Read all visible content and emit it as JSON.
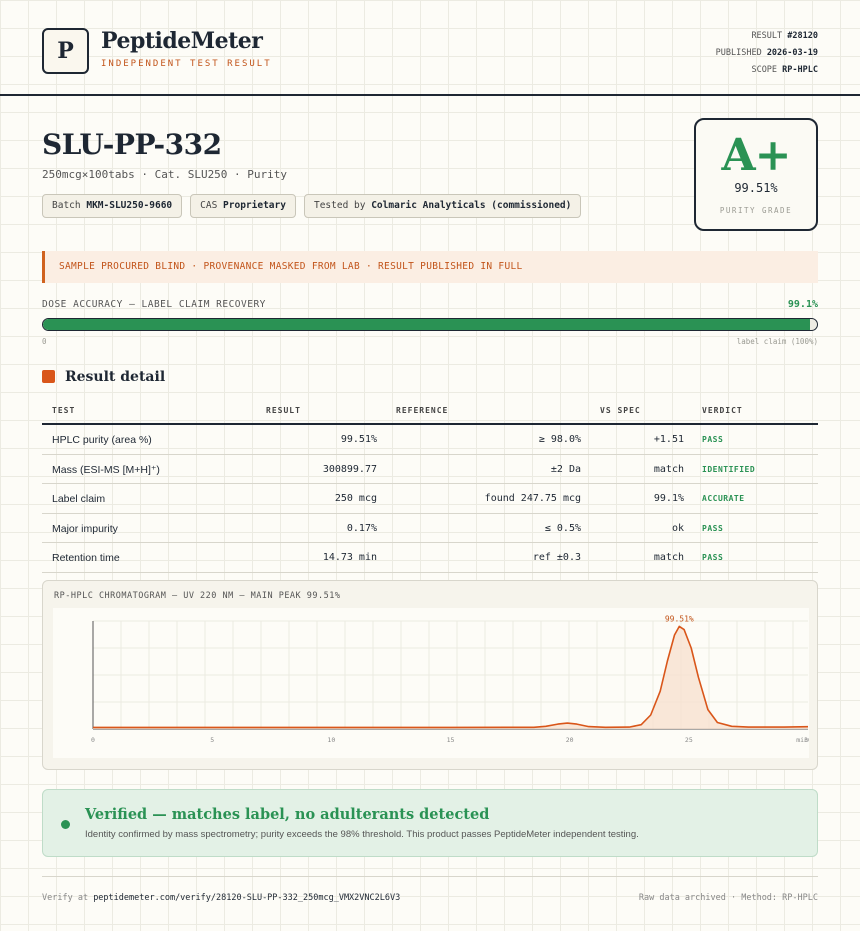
{
  "header": {
    "logo_letter": "P",
    "brand": "PeptideMeter",
    "tagline": "INDEPENDENT TEST RESULT",
    "result_label": "RESULT",
    "result_value": "#28120",
    "published_label": "PUBLISHED",
    "published_value": "2026-03-19",
    "scope_label": "SCOPE",
    "scope_value": "RP-HPLC"
  },
  "product": {
    "title": "SLU-PP-332",
    "subtitle": "250mcg×100tabs · Cat. SLU250 · Purity",
    "chips": [
      {
        "label": "Batch",
        "value": "MKM-SLU250-9660"
      },
      {
        "label": "CAS",
        "value": "Proprietary"
      },
      {
        "label": "Tested by",
        "value": "Colmaric Analyticals (commissioned)"
      }
    ]
  },
  "grade": {
    "letter": "A+",
    "value": "99.51%",
    "label": "PURITY GRADE"
  },
  "notice": "SAMPLE PROCURED BLIND · PROVENANCE MASKED FROM LAB · RESULT PUBLISHED IN FULL",
  "dose": {
    "label": "DOSE ACCURACY — LABEL CLAIM RECOVERY",
    "value": "99.1%",
    "fill_percent": 99.1,
    "zero_label": "0",
    "claim_label": "label claim (100%)"
  },
  "results": {
    "title": "Result detail",
    "headers": {
      "test": "TEST",
      "result": "RESULT",
      "reference": "REFERENCE",
      "vs_spec": "VS SPEC",
      "verdict": "VERDICT"
    },
    "rows": [
      {
        "test": "HPLC purity (area %)",
        "result": "99.51%",
        "reference": "≥ 98.0%",
        "vs_spec": "+1.51",
        "verdict": "PASS"
      },
      {
        "test": "Mass (ESI-MS [M+H]⁺)",
        "result": "300899.77",
        "reference": "±2 Da",
        "vs_spec": "match",
        "verdict": "IDENTIFIED"
      },
      {
        "test": "Label claim",
        "result": "250 mcg",
        "reference": "found 247.75 mcg",
        "vs_spec": "99.1%",
        "verdict": "ACCURATE"
      },
      {
        "test": "Major impurity",
        "result": "0.17%",
        "reference": "≤ 0.5%",
        "vs_spec": "ok",
        "verdict": "PASS"
      },
      {
        "test": "Retention time",
        "result": "14.73 min",
        "reference": "ref ±0.3",
        "vs_spec": "match",
        "verdict": "PASS"
      }
    ]
  },
  "chart_data": {
    "type": "line",
    "title": "RP-HPLC CHROMATOGRAM — UV 220 NM — MAIN PEAK 99.51%",
    "xlabel": "",
    "ylabel": "",
    "xlim": [
      0,
      30
    ],
    "ylim": [
      0,
      100
    ],
    "x_ticks": [
      "0",
      "5",
      "10",
      "15",
      "20",
      "25",
      "30"
    ],
    "x_unit": "min",
    "peak_label": "99.51%",
    "series": [
      {
        "x": [
          0,
          5,
          10,
          15,
          18.5,
          19.0,
          19.5,
          19.9,
          20.3,
          20.8,
          21.5,
          22.5,
          23.0,
          23.4,
          23.8,
          24.1,
          24.4,
          24.6,
          24.8,
          25.1,
          25.4,
          25.8,
          26.2,
          26.8,
          27.5,
          29,
          30
        ],
        "y": [
          1.5,
          1.5,
          1.5,
          1.5,
          1.6,
          2.5,
          4.5,
          5.5,
          4.5,
          2.2,
          1.6,
          1.8,
          4,
          13,
          35,
          63,
          87,
          95,
          92,
          75,
          48,
          18,
          6,
          2.5,
          1.8,
          1.8,
          2.1
        ]
      }
    ],
    "grid": true
  },
  "verified": {
    "title": "Verified — matches label, no adulterants detected",
    "subtitle": "Identity confirmed by mass spectrometry; purity exceeds the 98% threshold. This product passes PeptideMeter independent testing."
  },
  "footer": {
    "verify_prefix": "Verify at",
    "verify_url": "peptidemeter.com/verify/28120-SLU-PP-332_250mcg_VMX2VNC2L6V3",
    "right": "Raw data archived · Method: RP-HPLC"
  },
  "colors": {
    "accent_green": "#2a9254",
    "accent_orange": "#d9561a",
    "ink": "#1e2733"
  }
}
